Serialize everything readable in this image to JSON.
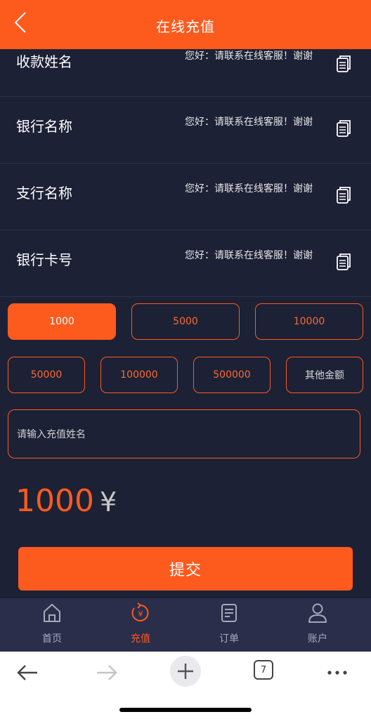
{
  "header": {
    "title": "在线充值"
  },
  "info_rows": [
    {
      "label": "收款姓名",
      "value": "您好：请联系在线客服！谢谢"
    },
    {
      "label": "银行名称",
      "value": "您好：请联系在线客服！谢谢"
    },
    {
      "label": "支行名称",
      "value": "您好：请联系在线客服！谢谢"
    },
    {
      "label": "银行卡号",
      "value": "您好：请联系在线客服！谢谢"
    }
  ],
  "amount_options": [
    "1000",
    "5000",
    "10000",
    "50000",
    "100000",
    "500000"
  ],
  "other_amount_label": "其他金额",
  "selected_amount": "1000",
  "name_input": {
    "placeholder": "请输入充值姓名",
    "value": ""
  },
  "total": {
    "amount": "1000",
    "currency": "¥"
  },
  "submit_label": "提交",
  "tabs": [
    {
      "label": "首页",
      "icon": "home-icon",
      "active": false
    },
    {
      "label": "充值",
      "icon": "recharge-icon",
      "active": true
    },
    {
      "label": "订单",
      "icon": "orders-icon",
      "active": false
    },
    {
      "label": "账户",
      "icon": "user-icon",
      "active": false
    }
  ],
  "browser": {
    "tab_count": "7"
  },
  "colors": {
    "accent": "#fd5a1e",
    "background": "#1c2136",
    "tabbar": "#2a2e4b"
  }
}
